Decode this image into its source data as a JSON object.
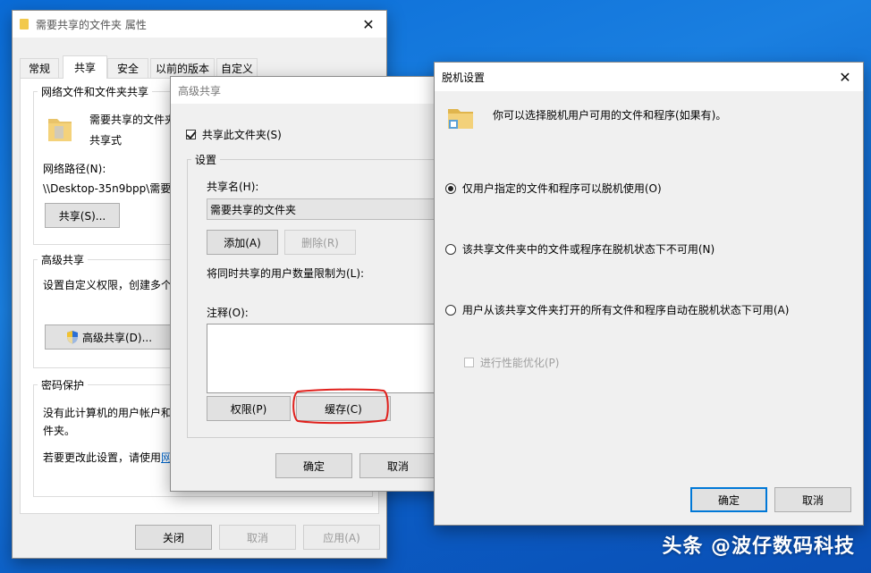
{
  "properties_dialog": {
    "title": "需要共享的文件夹 属性",
    "tabs": [
      "常规",
      "共享",
      "安全",
      "以前的版本",
      "自定义"
    ],
    "active_tab": "共享",
    "network_section": {
      "heading": "网络文件和文件夹共享",
      "folder_name": "需要共享的文件夹",
      "share_state": "共享式",
      "path_label": "网络路径(N):",
      "path_value": "\\\\Desktop-35n9bpp\\需要",
      "share_button": "共享(S)..."
    },
    "advanced_section": {
      "heading": "高级共享",
      "description": "设置自定义权限，创建多个",
      "button": "高级共享(D)..."
    },
    "password_section": {
      "heading": "密码保护",
      "text_line1": "没有此计算机的用户帐户和",
      "text_line2": "件夹。",
      "change_prefix": "若要更改此设置，请使用",
      "change_link": "网"
    },
    "buttons": {
      "close": "关闭",
      "cancel": "取消",
      "apply": "应用(A)"
    }
  },
  "advanced_dialog": {
    "title": "高级共享",
    "share_checkbox_label": "共享此文件夹(S)",
    "share_checkbox_checked": true,
    "settings_label": "设置",
    "share_name_label": "共享名(H):",
    "share_name_value": "需要共享的文件夹",
    "add_button": "添加(A)",
    "remove_button": "删除(R)",
    "limit_label": "将同时共享的用户数量限制为(L):",
    "comment_label": "注释(O):",
    "comment_value": "",
    "permissions_button": "权限(P)",
    "caching_button": "缓存(C)",
    "ok_button": "确定",
    "cancel_button": "取消",
    "highlight_color": "#e0201c"
  },
  "offline_dialog": {
    "title": "脱机设置",
    "description": "你可以选择脱机用户可用的文件和程序(如果有)。",
    "options": [
      {
        "label": "仅用户指定的文件和程序可以脱机使用(O)",
        "selected": true
      },
      {
        "label": "该共享文件夹中的文件或程序在脱机状态下不可用(N)",
        "selected": false
      },
      {
        "label": "用户从该共享文件夹打开的所有文件和程序自动在脱机状态下可用(A)",
        "selected": false
      }
    ],
    "optimize_label": "进行性能优化(P)",
    "ok_button": "确定",
    "cancel_button": "取消"
  },
  "watermark": "头条 @波仔数码科技",
  "icons": {
    "folder": "folder-icon",
    "shield": "uac-shield-icon",
    "close": "close-icon"
  },
  "colors": {
    "desktop": "#1a7fe0",
    "accent": "#0078d7",
    "link": "#0066cc"
  }
}
